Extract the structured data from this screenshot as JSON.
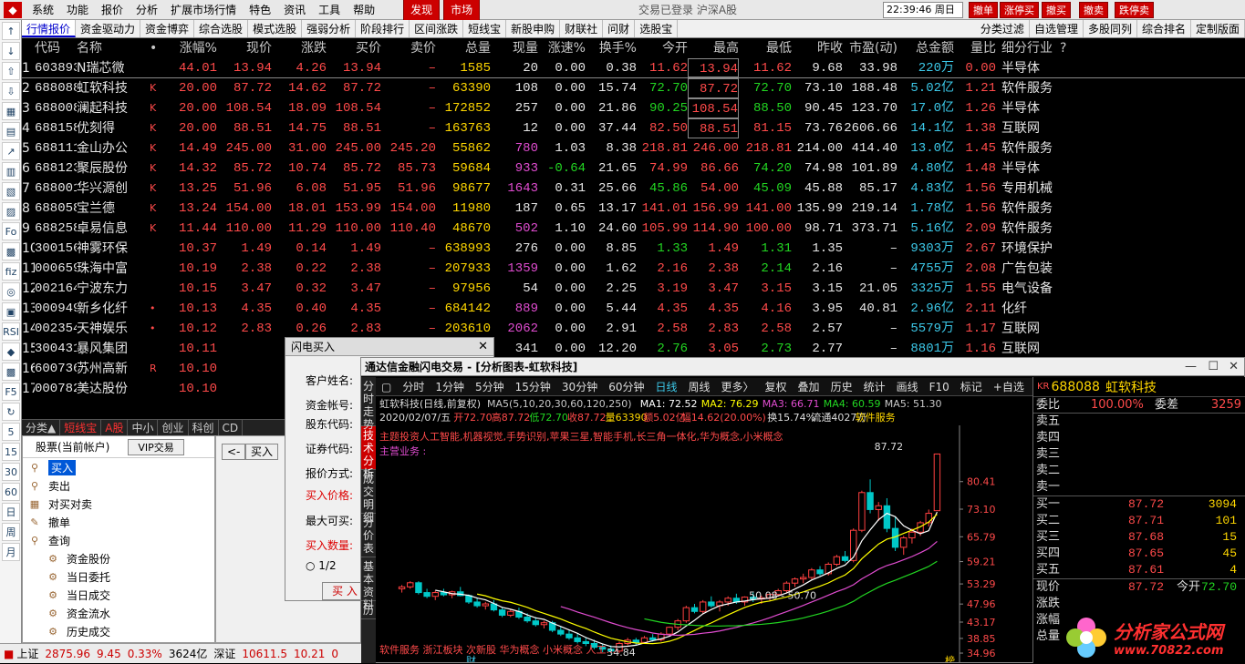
{
  "menubar": {
    "items": [
      "系统",
      "功能",
      "报价",
      "分析",
      "扩展市场行情",
      "特色",
      "资讯",
      "工具",
      "帮助"
    ],
    "tabs": [
      "发现",
      "市场"
    ],
    "status": "交易已登录 沪深A股",
    "clock": "22:39:46 周日",
    "right_buttons": [
      "撤单",
      "涨停买",
      "撤买",
      "撤卖",
      "跌停卖"
    ]
  },
  "tabbar": {
    "tabs": [
      "行情报价",
      "资金驱动力",
      "资金博弈",
      "综合选股",
      "模式选股",
      "强弱分析",
      "阶段排行",
      "区间涨跌",
      "短线宝",
      "新股申购",
      "财联社",
      "问财",
      "选股宝"
    ],
    "right": [
      "分类过滤",
      "自选管理",
      "多股同列",
      "综合排名",
      "定制版面"
    ]
  },
  "lefttool": [
    "↑",
    "↓",
    "⇧",
    "⇩",
    "▦",
    "▤",
    "↗",
    "▥",
    "▧",
    "▨",
    "Fo",
    "▩",
    "fiz",
    "◎",
    "▣",
    "RSI",
    "◆",
    "▩",
    "F5",
    "↻",
    "5",
    "15",
    "30",
    "60",
    "日",
    "周",
    "月"
  ],
  "quote": {
    "headers": [
      "",
      "代码",
      "名称",
      "•",
      "涨幅%",
      "现价",
      "涨跌",
      "买价",
      "卖价",
      "总量",
      "现量",
      "涨速%",
      "换手%",
      "今开",
      "最高",
      "最低",
      "昨收",
      "市盈(动)",
      "总金额",
      "量比",
      "细分行业",
      "?"
    ],
    "rows": [
      [
        "1",
        "603893",
        "N瑞芯微",
        "",
        "44.01",
        "13.94",
        "4.26",
        "13.94",
        "–",
        "1585",
        "20",
        "0.00",
        "0.38",
        "11.62",
        "13.94",
        "11.62",
        "9.68",
        "33.98",
        "220万",
        "0.00",
        "半导体"
      ],
      [
        "2",
        "688088",
        "虹软科技",
        "K",
        "20.00",
        "87.72",
        "14.62",
        "87.72",
        "–",
        "63390",
        "108",
        "0.00",
        "15.74",
        "72.70",
        "87.72",
        "72.70",
        "73.10",
        "188.48",
        "5.02亿",
        "1.21",
        "软件服务"
      ],
      [
        "3",
        "688008",
        "澜起科技",
        "K",
        "20.00",
        "108.54",
        "18.09",
        "108.54",
        "–",
        "172852",
        "257",
        "0.00",
        "21.86",
        "90.25",
        "108.54",
        "88.50",
        "90.45",
        "123.70",
        "17.0亿",
        "1.26",
        "半导体"
      ],
      [
        "4",
        "688158",
        "优刻得",
        "K",
        "20.00",
        "88.51",
        "14.75",
        "88.51",
        "–",
        "163763",
        "12",
        "0.00",
        "37.44",
        "82.50",
        "88.51",
        "81.15",
        "73.76",
        "2606.66",
        "14.1亿",
        "1.38",
        "互联网"
      ],
      [
        "5",
        "688111",
        "金山办公",
        "K",
        "14.49",
        "245.00",
        "31.00",
        "245.00",
        "245.20",
        "55862",
        "780",
        "1.03",
        "8.38",
        "218.81",
        "246.00",
        "218.81",
        "214.00",
        "414.40",
        "13.0亿",
        "1.45",
        "软件服务"
      ],
      [
        "6",
        "688123",
        "聚辰股份",
        "K",
        "14.32",
        "85.72",
        "10.74",
        "85.72",
        "85.73",
        "59684",
        "933",
        "-0.64",
        "21.65",
        "74.99",
        "86.66",
        "74.20",
        "74.98",
        "101.89",
        "4.80亿",
        "1.48",
        "半导体"
      ],
      [
        "7",
        "688001",
        "华兴源创",
        "K",
        "13.25",
        "51.96",
        "6.08",
        "51.95",
        "51.96",
        "98677",
        "1643",
        "0.31",
        "25.66",
        "45.86",
        "54.00",
        "45.09",
        "45.88",
        "85.17",
        "4.83亿",
        "1.56",
        "专用机械"
      ],
      [
        "8",
        "688058",
        "宝兰德",
        "K",
        "13.24",
        "154.00",
        "18.01",
        "153.99",
        "154.00",
        "11980",
        "187",
        "0.65",
        "13.17",
        "141.01",
        "156.99",
        "141.00",
        "135.99",
        "219.14",
        "1.78亿",
        "1.56",
        "软件服务"
      ],
      [
        "9",
        "688258",
        "卓易信息",
        "K",
        "11.44",
        "110.00",
        "11.29",
        "110.00",
        "110.40",
        "48670",
        "502",
        "1.10",
        "24.60",
        "105.99",
        "114.90",
        "100.00",
        "98.71",
        "373.71",
        "5.16亿",
        "2.09",
        "软件服务"
      ],
      [
        "10",
        "300156",
        "神雾环保",
        "",
        "10.37",
        "1.49",
        "0.14",
        "1.49",
        "–",
        "638993",
        "276",
        "0.00",
        "8.85",
        "1.33",
        "1.49",
        "1.31",
        "1.35",
        "–",
        "9303万",
        "2.67",
        "环境保护"
      ],
      [
        "11",
        "000659",
        "珠海中富",
        "",
        "10.19",
        "2.38",
        "0.22",
        "2.38",
        "–",
        "207933",
        "1359",
        "0.00",
        "1.62",
        "2.16",
        "2.38",
        "2.14",
        "2.16",
        "–",
        "4755万",
        "2.08",
        "广告包装"
      ],
      [
        "12",
        "002164",
        "宁波东力",
        "",
        "10.15",
        "3.47",
        "0.32",
        "3.47",
        "–",
        "97956",
        "54",
        "0.00",
        "2.25",
        "3.19",
        "3.47",
        "3.15",
        "3.15",
        "21.05",
        "3325万",
        "1.55",
        "电气设备"
      ],
      [
        "13",
        "000949",
        "新乡化纤",
        "•",
        "10.13",
        "4.35",
        "0.40",
        "4.35",
        "–",
        "684142",
        "889",
        "0.00",
        "5.44",
        "4.35",
        "4.35",
        "4.16",
        "3.95",
        "40.81",
        "2.96亿",
        "2.11",
        "化纤"
      ],
      [
        "14",
        "002354",
        "天神娱乐",
        "•",
        "10.12",
        "2.83",
        "0.26",
        "2.83",
        "–",
        "203610",
        "2062",
        "0.00",
        "2.91",
        "2.58",
        "2.83",
        "2.58",
        "2.57",
        "–",
        "5579万",
        "1.17",
        "互联网"
      ],
      [
        "15",
        "300431",
        "暴风集团",
        "",
        "10.11",
        "",
        "",
        "",
        "",
        "296542",
        "341",
        "0.00",
        "12.20",
        "2.76",
        "3.05",
        "2.73",
        "2.77",
        "–",
        "8801万",
        "1.16",
        "互联网"
      ],
      [
        "16",
        "600736",
        "苏州高新",
        "R",
        "10.10",
        "",
        "",
        "",
        "",
        "",
        "",
        "",
        "",
        "",
        "",
        "",
        "",
        "",
        "",
        "",
        ""
      ],
      [
        "17",
        "000782",
        "美达股份",
        "",
        "10.10",
        "",
        "",
        "",
        "",
        "",
        "",
        "",
        "",
        "",
        "",
        "",
        "",
        "",
        "",
        "",
        ""
      ]
    ]
  },
  "cattabs": [
    "分类▲",
    "短线宝",
    "A股",
    "中小",
    "创业",
    "科创",
    "CD"
  ],
  "trade": {
    "account": "股票(当前帐户)",
    "vip": "VIP交易",
    "items": [
      "买入",
      "卖出",
      "对买对卖",
      "撤单",
      "查询"
    ],
    "sub": [
      "资金股份",
      "当日委托",
      "当日成交",
      "资金流水",
      "历史成交"
    ]
  },
  "mid": {
    "back": "<-",
    "buy": "买入"
  },
  "flashbuy": {
    "title": "闪电买入",
    "labels": [
      "客户姓名:",
      "资金帐号:",
      "股东代码:",
      "证券代码:",
      "报价方式:",
      "买入价格:",
      "最大可买:",
      "买入数量:"
    ],
    "radio": "1/2",
    "ok": "买 入"
  },
  "chartwin": {
    "title": "通达信金融闪电交易 - [分析图表-虹软科技]",
    "vtabs": [
      "分时走势",
      "技术分析",
      "成交明细",
      "分价表",
      "基本资料",
      "历"
    ],
    "ptabs": [
      "分时",
      "1分钟",
      "5分钟",
      "15分钟",
      "30分钟",
      "60分钟",
      "日线",
      "周线",
      "更多〉",
      "复权",
      "叠加",
      "历史",
      "统计",
      "画线",
      "F10",
      "标记",
      "+自选",
      "返回"
    ],
    "info1": "虹软科技(日线,前复权)",
    "ma_labels": [
      [
        "MA5(5,10,20,30,60,120,250)",
        "#c8c8c8"
      ],
      [
        "MA1: 72.52",
        "#ffffff"
      ],
      [
        "MA2: 76.29",
        "#ffff00"
      ],
      [
        "MA3: 66.71",
        "#e04cd0"
      ],
      [
        "MA4: 60.59",
        "#22d622"
      ],
      [
        "MA5: 51.30",
        "#c8c8c8"
      ]
    ],
    "info2": [
      "2020/02/07/五",
      "开72.70",
      "高87.72",
      "低72.70",
      "收87.72",
      "量63390",
      "额5.02亿",
      "幅14.62(20.00%)",
      "换15.74%",
      "流通4027万",
      "软件服务"
    ],
    "theme": "主题投资人工智能,机器视觉,手势识别,苹果三星,智能手机,长三角一体化,华为概念,小米概念",
    "main_biz": "主营业务 :",
    "concepts": "软件服务 浙江板块 次新股 华为概念 小米概念 人工...",
    "price_axis": [
      "80.41",
      "73.10",
      "65.79",
      "59.21",
      "53.29",
      "47.96",
      "43.17",
      "38.85",
      "34.96"
    ],
    "high_mark": "87.72",
    "low_mark": "34.84",
    "range_label": "50.08 - 50.70",
    "bottom_marks": [
      "财",
      "榜"
    ]
  },
  "orderbook": {
    "code_badge": "KR",
    "code": "688088",
    "name": "虹软科技",
    "ratio_label": "委比",
    "ratio": "100.00%",
    "diff_label": "委差",
    "diff": "3259",
    "sells": [
      "卖五",
      "卖四",
      "卖三",
      "卖二",
      "卖一"
    ],
    "buys": [
      [
        "买一",
        "87.72",
        "3094"
      ],
      [
        "买二",
        "87.71",
        "101"
      ],
      [
        "买三",
        "87.68",
        "15"
      ],
      [
        "买四",
        "87.65",
        "45"
      ],
      [
        "买五",
        "87.61",
        "4"
      ]
    ],
    "stats": [
      [
        "现价",
        "87.72",
        "今开",
        "72.70"
      ],
      [
        "涨跌",
        ""
      ],
      [
        "涨幅",
        ""
      ],
      [
        "总量",
        ""
      ]
    ]
  },
  "footer": {
    "items": [
      [
        "上证",
        "#000"
      ],
      [
        "2875.96",
        "#c00"
      ],
      [
        "9.45",
        "#c00"
      ],
      [
        "0.33%",
        "#c00"
      ],
      [
        "3624亿",
        "#000"
      ],
      [
        "深证",
        "#000"
      ],
      [
        "10611.5",
        "#c00"
      ],
      [
        "10.21",
        "#c00"
      ],
      [
        "0",
        "#c00"
      ]
    ]
  },
  "watermark": {
    "text": "分析家公式网",
    "url": "www.70822.com"
  },
  "chart_data": {
    "type": "candlestick",
    "title": "虹软科技(日线,前复权)",
    "y_axis": [
      80.41,
      73.1,
      65.79,
      59.21,
      53.29,
      47.96,
      43.17,
      38.85,
      34.96
    ],
    "candles": [
      [
        52,
        53,
        51,
        52.5
      ],
      [
        52.5,
        54,
        52,
        53.6
      ],
      [
        53.6,
        54,
        50.5,
        51
      ],
      [
        51,
        52,
        49.5,
        50
      ],
      [
        50,
        51.5,
        49,
        51
      ],
      [
        51,
        52,
        50,
        50.4
      ],
      [
        50.4,
        51.5,
        49.5,
        51.2
      ],
      [
        51.2,
        52.5,
        50,
        50.2
      ],
      [
        50.2,
        50.5,
        48,
        48.5
      ],
      [
        48.5,
        49.5,
        47,
        47.5
      ],
      [
        47.5,
        48.5,
        46.5,
        48
      ],
      [
        48,
        49,
        46,
        46.4
      ],
      [
        46.4,
        47,
        44.5,
        45
      ],
      [
        45,
        46.5,
        44.5,
        46
      ],
      [
        46,
        47,
        44,
        44.5
      ],
      [
        44.5,
        45.5,
        43,
        43.5
      ],
      [
        43.5,
        44.5,
        42,
        42.5
      ],
      [
        42.5,
        43.5,
        41.5,
        43
      ],
      [
        43,
        43.5,
        40.5,
        41
      ],
      [
        41,
        42,
        39.5,
        40
      ],
      [
        40,
        41,
        38.5,
        39
      ],
      [
        39,
        40,
        37.5,
        38
      ],
      [
        38,
        39,
        36.8,
        37.5
      ],
      [
        37.5,
        38.5,
        36,
        36.5
      ],
      [
        36.5,
        37.5,
        35.2,
        36
      ],
      [
        36,
        37,
        34.84,
        35.5
      ],
      [
        35.5,
        38,
        35,
        37.5
      ],
      [
        37.5,
        39,
        37,
        38.4
      ],
      [
        38.4,
        39,
        37,
        37.8
      ],
      [
        37.8,
        39.5,
        37.5,
        39
      ],
      [
        39,
        40,
        38,
        38.5
      ],
      [
        38.5,
        40.5,
        38,
        40
      ],
      [
        40,
        42,
        39.5,
        41.8
      ],
      [
        41.8,
        44,
        41,
        43.5
      ],
      [
        43.5,
        47.5,
        43,
        47
      ],
      [
        47,
        48,
        45.5,
        46
      ],
      [
        46,
        49,
        45.5,
        48.5
      ],
      [
        48.5,
        50,
        47,
        47.5
      ],
      [
        47.5,
        49,
        46,
        48.5
      ],
      [
        48.5,
        50,
        47.5,
        49.5
      ],
      [
        49.5,
        50.7,
        48,
        48.5
      ],
      [
        48.5,
        50,
        47.5,
        49.8
      ],
      [
        49.8,
        51,
        48.5,
        49.3
      ],
      [
        49.3,
        50.2,
        48,
        49.6
      ],
      [
        49.6,
        51,
        48.8,
        50.5
      ],
      [
        50.5,
        52,
        50,
        51.5
      ],
      [
        51.5,
        54,
        51,
        53.5
      ],
      [
        53.5,
        55,
        52.5,
        54.6
      ],
      [
        54.6,
        56,
        53.5,
        55
      ],
      [
        55,
        57.5,
        54.5,
        57
      ],
      [
        57,
        58,
        55.5,
        56
      ],
      [
        56,
        59,
        55.5,
        58.5
      ],
      [
        58.5,
        61,
        58,
        60.5
      ],
      [
        60.5,
        62,
        59,
        59.5
      ],
      [
        59.5,
        68,
        59,
        67.5
      ],
      [
        67.5,
        78,
        67,
        77.5
      ],
      [
        77.5,
        81,
        72,
        73
      ],
      [
        73,
        75,
        70,
        74
      ],
      [
        74,
        76,
        67,
        68
      ],
      [
        68,
        71,
        62,
        63
      ],
      [
        63,
        66,
        61,
        65.5
      ],
      [
        65.5,
        68,
        64,
        67
      ],
      [
        67,
        70,
        66,
        69.5
      ],
      [
        69.5,
        73,
        68.5,
        72
      ],
      [
        72.7,
        87.72,
        72.7,
        87.72
      ]
    ]
  }
}
